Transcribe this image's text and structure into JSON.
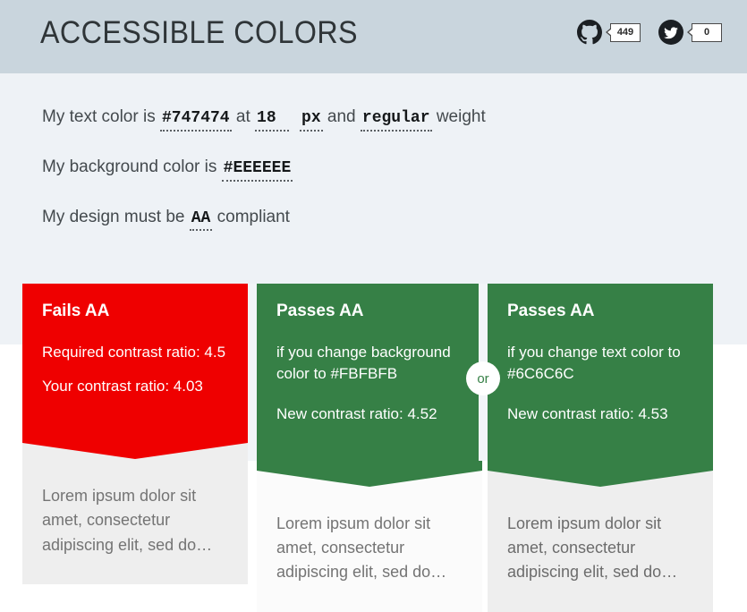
{
  "header": {
    "title": "ACCESSIBLE COLORS",
    "background_color": "#C9D5DD",
    "social": [
      {
        "icon": "github-icon",
        "label": "GitHub",
        "count": "449"
      },
      {
        "icon": "twitter-icon",
        "label": "Twitter",
        "count": "0"
      }
    ]
  },
  "form": {
    "sentences": [
      {
        "id": "text-color-sentence",
        "parts": [
          {
            "type": "text",
            "value": "My text color is "
          },
          {
            "type": "field",
            "name": "text-color-field",
            "value": "#747474"
          },
          {
            "type": "text",
            "value": " at "
          },
          {
            "type": "field",
            "name": "font-size-field",
            "value": "18"
          },
          {
            "type": "field",
            "name": "font-unit-field",
            "value": "px"
          },
          {
            "type": "text",
            "value": " and "
          },
          {
            "type": "field",
            "name": "font-weight-field",
            "value": "regular"
          },
          {
            "type": "text",
            "value": " weight"
          }
        ]
      },
      {
        "id": "background-color-sentence",
        "parts": [
          {
            "type": "text",
            "value": "My background color is "
          },
          {
            "type": "field",
            "name": "background-color-field",
            "value": "#EEEEEE"
          }
        ]
      },
      {
        "id": "compliance-sentence",
        "parts": [
          {
            "type": "text",
            "value": "My design must be "
          },
          {
            "type": "field",
            "name": "compliance-level-field",
            "value": "AA"
          },
          {
            "type": "text",
            "value": " compliant"
          }
        ]
      }
    ],
    "labels": {
      "text_color_prefix": "My text color is",
      "text_color_value": "#747474",
      "at": "at",
      "font_size_value": "18",
      "font_unit_value": "px",
      "and": "and",
      "font_weight_value": "regular",
      "weight_suffix": "weight",
      "background_prefix": "My background color is",
      "background_value": "#EEEEEE",
      "compliance_prefix": "My design must be",
      "compliance_value": "AA",
      "compliance_suffix": "compliant"
    }
  },
  "connectors": [
    {
      "label": "or",
      "visible": false
    },
    {
      "label": "or",
      "visible": true
    }
  ],
  "results": {
    "preview_text": "Lorem ipsum dolor sit amet, consectetur adipiscing elit, sed do…",
    "cards": [
      {
        "id": "result-card-fail",
        "status": "Fails AA",
        "state": "fail",
        "banner_color": "#EF0000",
        "suggestion": "",
        "lines": [
          "Required contrast ratio: 4.5",
          "Your contrast ratio: 4.03"
        ],
        "preview_background": "#EEEEEE",
        "preview_color": "#747474",
        "preview_text": "Lorem ipsum dolor sit amet, consectetur adipiscing elit, sed do…"
      },
      {
        "id": "result-card-pass-background",
        "status": "Passes AA",
        "state": "pass",
        "banner_color": "#368046",
        "suggestion": "if you change background color to #FBFBFB",
        "lines": [
          "New contrast ratio: 4.52"
        ],
        "preview_background": "#FBFBFB",
        "preview_color": "#747474",
        "preview_text": "Lorem ipsum dolor sit amet, consectetur adipiscing elit, sed do…"
      },
      {
        "id": "result-card-pass-text",
        "status": "Passes AA",
        "state": "pass",
        "banner_color": "#368046",
        "suggestion": "if you change text color to #6C6C6C",
        "lines": [
          "New contrast ratio: 4.53"
        ],
        "preview_background": "#EEEEEE",
        "preview_color": "#6C6C6C",
        "preview_text": "Lorem ipsum dolor sit amet, consectetur adipiscing elit, sed do…"
      }
    ]
  }
}
